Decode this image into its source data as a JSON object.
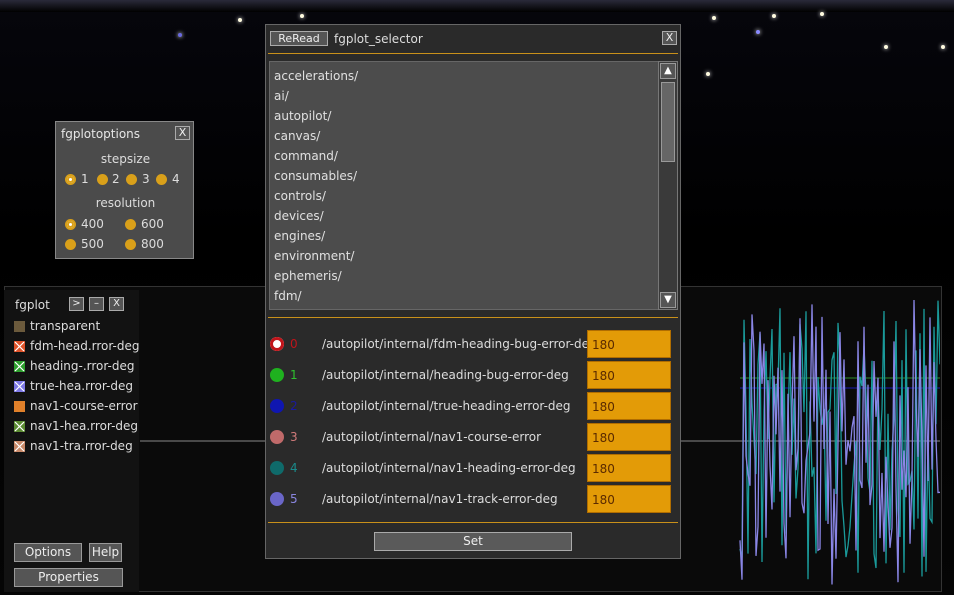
{
  "scene": {
    "sky_label": ""
  },
  "options_dialog": {
    "title": "fgplotoptions",
    "close_label": "X",
    "stepsize_label": "stepsize",
    "stepsize_options": [
      "1",
      "2",
      "3",
      "4"
    ],
    "stepsize_selected": "1",
    "resolution_label": "resolution",
    "resolution_options": [
      "400",
      "600",
      "500",
      "800"
    ],
    "resolution_selected": "400"
  },
  "plot": {
    "title": "fgplot",
    "btn_next": ">",
    "btn_min": "–",
    "btn_close": "X",
    "legend": [
      {
        "label": "transparent",
        "color": "#6b5a3c",
        "icon": "plain-box"
      },
      {
        "label": "fdm-head.rror-deg",
        "color": "#e0532a",
        "icon": "x-box"
      },
      {
        "label": "heading-.rror-deg",
        "color": "#2ea02e",
        "icon": "x-box"
      },
      {
        "label": "true-hea.rror-deg",
        "color": "#7e79e6",
        "icon": "x-box"
      },
      {
        "label": "nav1-course-error",
        "color": "#e0802a",
        "icon": "plain-box"
      },
      {
        "label": "nav1-hea.rror-deg",
        "color": "#5c8c33",
        "icon": "x-box"
      },
      {
        "label": "nav1-tra.rror-deg",
        "color": "#c98a6a",
        "icon": "x-box"
      }
    ],
    "options_label": "Options",
    "help_label": "Help",
    "properties_label": "Properties"
  },
  "selector": {
    "reread_label": "ReRead",
    "title": "fgplot_selector",
    "close_label": "X",
    "list": [
      "accelerations/",
      "ai/",
      "autopilot/",
      "canvas/",
      "command/",
      "consumables/",
      "controls/",
      "devices/",
      "engines/",
      "environment/",
      "ephemeris/",
      "fdm/"
    ],
    "rows": [
      {
        "num": "0",
        "color": "#c0141a",
        "numcolor": "#c0141a",
        "selected": true,
        "path": "/autopilot/internal/fdm-heading-bug-error-deg",
        "value": "180"
      },
      {
        "num": "1",
        "color": "#1fb11f",
        "numcolor": "#2ec02e",
        "selected": false,
        "path": "/autopilot/internal/heading-bug-error-deg",
        "value": "180"
      },
      {
        "num": "2",
        "color": "#0f16b0",
        "numcolor": "#1a1aa0",
        "selected": false,
        "path": "/autopilot/internal/true-heading-error-deg",
        "value": "180"
      },
      {
        "num": "3",
        "color": "#c06a6a",
        "numcolor": "#d07a7a",
        "selected": false,
        "path": "/autopilot/internal/nav1-course-error",
        "value": "180"
      },
      {
        "num": "4",
        "color": "#0f6a6a",
        "numcolor": "#1a8a8a",
        "selected": false,
        "path": "/autopilot/internal/nav1-heading-error-deg",
        "value": "180"
      },
      {
        "num": "5",
        "color": "#6a66c8",
        "numcolor": "#8a86e0",
        "selected": false,
        "path": "/autopilot/internal/nav1-track-error-deg",
        "value": "180"
      }
    ],
    "set_label": "Set"
  }
}
